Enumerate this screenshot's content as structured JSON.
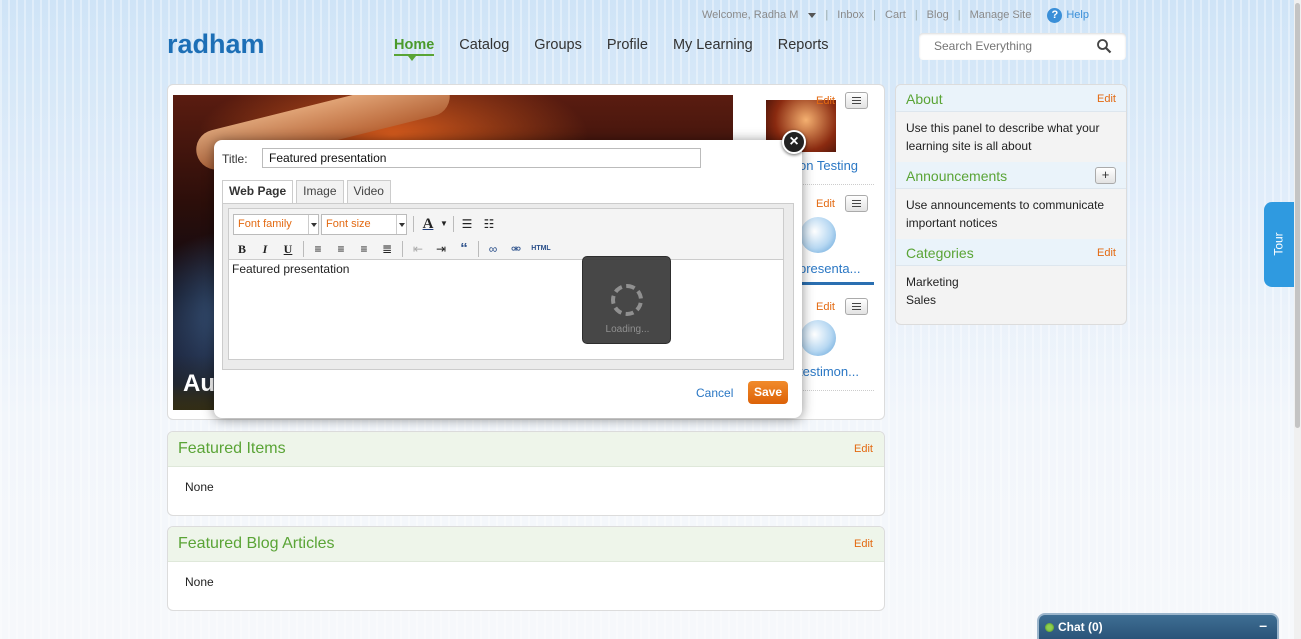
{
  "topbar": {
    "welcome": "Welcome, Radha M",
    "links": [
      "Inbox",
      "Cart",
      "Blog",
      "Manage Site"
    ],
    "help": "Help"
  },
  "header": {
    "logo": "radham",
    "nav": [
      "Home",
      "Catalog",
      "Groups",
      "Profile",
      "My Learning",
      "Reports"
    ],
    "search_placeholder": "Search Everything"
  },
  "hero": {
    "caption": "Au"
  },
  "thumbs": [
    {
      "edit": "Edit",
      "title": "on Testing"
    },
    {
      "edit": "Edit",
      "title": "presenta..."
    },
    {
      "edit": "Edit",
      "title": "testimon..."
    }
  ],
  "featured_items": {
    "title": "Featured Items",
    "edit": "Edit",
    "body": "None"
  },
  "featured_blog": {
    "title": "Featured Blog Articles",
    "edit": "Edit",
    "body": "None"
  },
  "sidebar": {
    "about": {
      "title": "About",
      "edit": "Edit",
      "body": "Use this panel to describe what your learning site is all about"
    },
    "announcements": {
      "title": "Announcements",
      "plus": "+",
      "body": "Use announcements to communicate important notices"
    },
    "categories": {
      "title": "Categories",
      "edit": "Edit",
      "items": [
        "Marketing",
        "Sales"
      ]
    }
  },
  "tour": "Tour",
  "chat": {
    "label": "Chat  (0)",
    "minimize": "–"
  },
  "modal": {
    "title_label": "Title:",
    "title_value": "Featured presentation",
    "tabs": [
      "Web Page",
      "Image",
      "Video"
    ],
    "font_family": "Font family",
    "font_size": "Font size",
    "content": "Featured presentation",
    "loading": "Loading...",
    "cancel": "Cancel",
    "save": "Save",
    "close": "×"
  },
  "colors": {
    "accent_green": "#5aa436",
    "brand_blue": "#1d6fb6",
    "edit_orange": "#e36a12",
    "save_orange": "#e87418"
  }
}
